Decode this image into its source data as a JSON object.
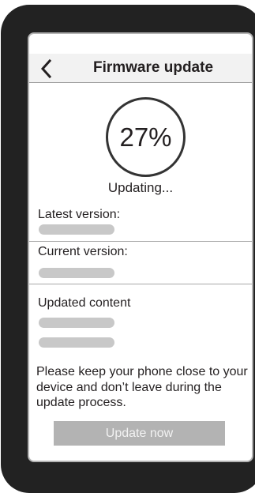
{
  "header": {
    "title": "Firmware update",
    "back_icon": "chevron-left-icon"
  },
  "progress": {
    "percent": 27,
    "display": "27%",
    "status": "Updating..."
  },
  "info": {
    "latest_version_label": "Latest version:",
    "current_version_label": "Current version:",
    "updated_content_label": "Updated content"
  },
  "notice": "Please keep your phone close to your device and don’t leave during the update process.",
  "actions": {
    "update_label": "Update now"
  },
  "colors": {
    "frame": "#222222",
    "header_bg": "#f2f2f2",
    "placeholder": "#c8c8c8",
    "button_bg": "#b3b3b3",
    "text": "#231f20"
  }
}
